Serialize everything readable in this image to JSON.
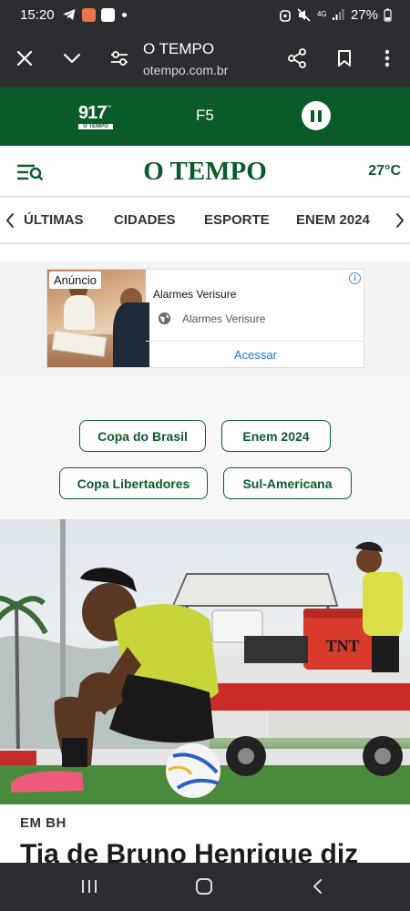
{
  "status_bar": {
    "time": "15:20",
    "battery": "27%",
    "network": "4G",
    "icons": [
      "telegram-icon",
      "app-icon",
      "app-icon",
      "dot-icon",
      "alarm-icon",
      "mute-icon",
      "signal-icon",
      "battery-icon"
    ]
  },
  "browser": {
    "page_title": "O TEMPO",
    "url": "otempo.com.br",
    "icons": [
      "close-icon",
      "chevron-down-icon",
      "site-settings-icon",
      "share-icon",
      "bookmark-icon",
      "more-icon"
    ]
  },
  "radio": {
    "logo_number": "917",
    "logo_sub": "O TEMPO",
    "logo_fm": "FM",
    "station": "F5",
    "icon": "pause-icon"
  },
  "site_header": {
    "brand": "O TEMPO",
    "temperature": "27°C",
    "icon": "menu-search-icon"
  },
  "nav": {
    "items": [
      "ÚLTIMAS",
      "CIDADES",
      "ESPORTE",
      "ENEM 2024"
    ],
    "icons": [
      "chevron-left-icon",
      "chevron-right-icon"
    ]
  },
  "ad": {
    "label": "Anúncio",
    "headline": "Alarmes Verisure",
    "advertiser": "Alarmes Verisure",
    "cta": "Acessar",
    "icons": [
      "info-icon",
      "globe-icon"
    ]
  },
  "topic_tags": [
    "Copa do Brasil",
    "Enem 2024",
    "Copa Libertadores",
    "Sul-Americana"
  ],
  "article": {
    "kicker": "EM BH",
    "headline": "Tia de Bruno Henrique diz",
    "photo_text": "TNT"
  },
  "system_nav": {
    "icons": [
      "recent-apps-icon",
      "home-icon",
      "back-icon"
    ]
  },
  "colors": {
    "brand_green": "#0b5b2a",
    "chrome_dark": "#2b2d30",
    "link_blue": "#1a73e8"
  }
}
